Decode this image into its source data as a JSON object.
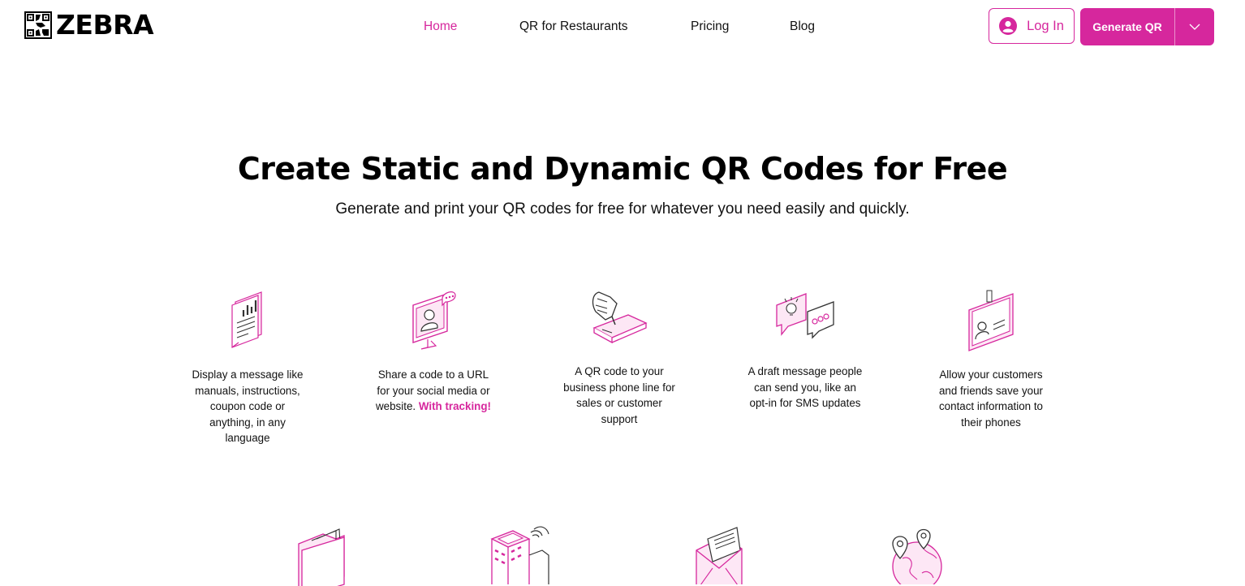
{
  "brand": {
    "name": "ZEBRA",
    "accent": "#d6279d"
  },
  "nav": {
    "items": [
      {
        "label": "Home",
        "active": true
      },
      {
        "label": "QR for Restaurants",
        "active": false
      },
      {
        "label": "Pricing",
        "active": false
      },
      {
        "label": "Blog",
        "active": false
      }
    ]
  },
  "header": {
    "login_label": "Log In",
    "generate_label": "Generate QR"
  },
  "hero": {
    "title": "Create Static and Dynamic QR Codes for Free",
    "subtitle": "Generate and print your QR codes for free for whatever you need easily and quickly."
  },
  "features": [
    {
      "icon": "document-chart-icon",
      "text": "Display a message like manuals, instructions, coupon code or anything, in any language"
    },
    {
      "icon": "monitor-profile-chat-icon",
      "text": "Share a code to a URL for your social media or website.",
      "highlight": "With tracking!"
    },
    {
      "icon": "hand-phone-icon",
      "text": "A QR code  to your business phone line for sales or customer support"
    },
    {
      "icon": "speech-bubbles-icon",
      "text": "A draft message people can send you, like an opt-in for SMS updates"
    },
    {
      "icon": "id-badge-icon",
      "text": "Allow your customers and friends save your contact information to their phones"
    }
  ],
  "bottom_icons": [
    {
      "icon": "folder-files-icon"
    },
    {
      "icon": "building-wifi-icon"
    },
    {
      "icon": "envelope-letter-icon"
    },
    {
      "icon": "globe-location-icon"
    }
  ]
}
